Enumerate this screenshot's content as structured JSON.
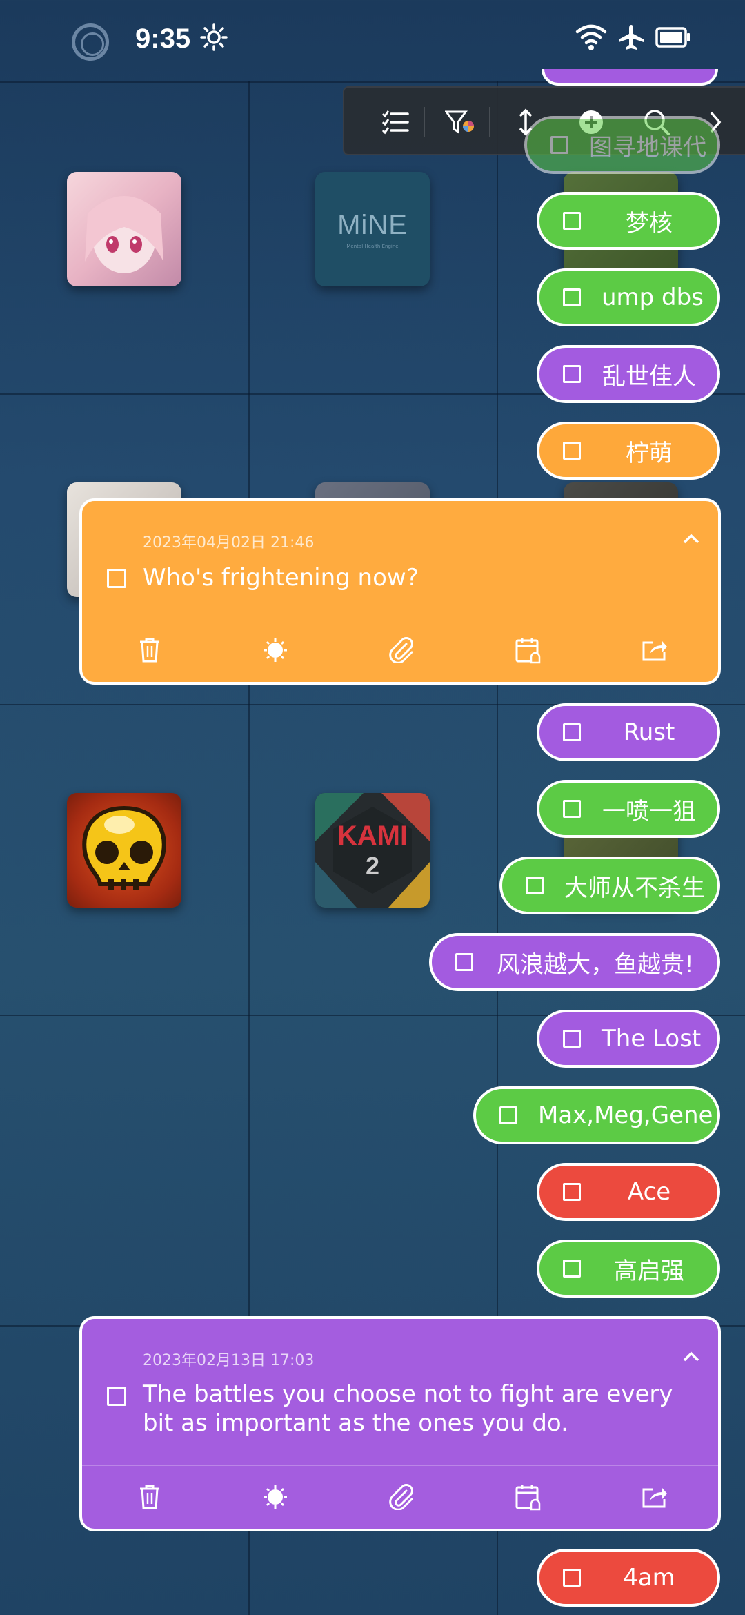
{
  "status_bar": {
    "time": "9:35"
  },
  "toolbar": {
    "icons": [
      "list-icon",
      "filter-icon",
      "sort-icon",
      "add-icon",
      "search-icon",
      "chevron-right-icon"
    ]
  },
  "pills": [
    {
      "label": "图寻地课代",
      "color": "green"
    },
    {
      "label": "梦核",
      "color": "green"
    },
    {
      "label": "ump dbs",
      "color": "green"
    },
    {
      "label": "乱世佳人",
      "color": "purple"
    },
    {
      "label": "柠萌",
      "color": "orange"
    },
    {
      "label": "Rust",
      "color": "purple"
    },
    {
      "label": "一喷一狙",
      "color": "green"
    },
    {
      "label": "大师从不杀生",
      "color": "green"
    },
    {
      "label": "风浪越大，鱼越贵!",
      "color": "purple"
    },
    {
      "label": "The Lost",
      "color": "purple"
    },
    {
      "label": "Max,Meg,Gene",
      "color": "green"
    },
    {
      "label": "Ace",
      "color": "red"
    },
    {
      "label": "高启强",
      "color": "green"
    },
    {
      "label": "4am",
      "color": "red"
    }
  ],
  "cards": [
    {
      "date": "2023年04月02日 21:46",
      "text": "Who's frightening now?",
      "color": "orange"
    },
    {
      "date": "2023年02月13日 17:03",
      "text": "The battles you choose not to fight are every bit as important as the ones you do.",
      "color": "purple"
    }
  ],
  "card_actions": [
    "trash-icon",
    "brightness-icon",
    "paperclip-icon",
    "calendar-reminder-icon",
    "share-icon"
  ],
  "app_icons": {
    "mine_label": "MiNE",
    "mine_sub": "Mental Health Engine",
    "kami_label": "KAMI",
    "kami_num": "2"
  },
  "colors": {
    "green": "#5ccb45",
    "purple": "#a35be0",
    "orange": "#fea83a",
    "red": "#ec4a3e"
  }
}
